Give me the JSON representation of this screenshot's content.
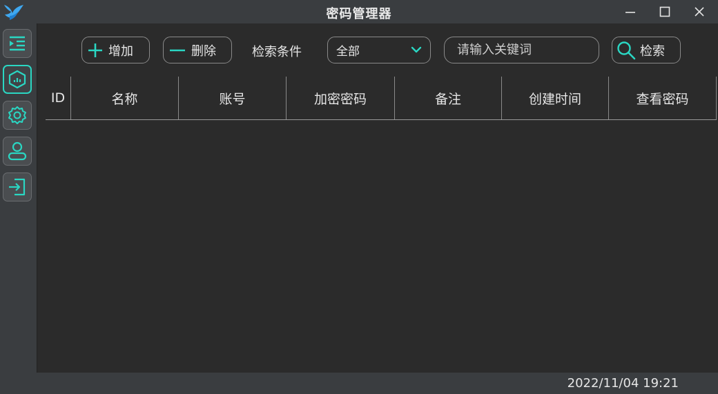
{
  "window": {
    "title": "密码管理器"
  },
  "toolbar": {
    "add_label": "增加",
    "delete_label": "删除",
    "condition_label": "检索条件",
    "condition_value": "全部",
    "search_placeholder": "请输入关键词",
    "search_label": "检索"
  },
  "table": {
    "columns": [
      "ID",
      "名称",
      "账号",
      "加密密码",
      "备注",
      "创建时间",
      "查看密码"
    ],
    "rows": []
  },
  "sidebar": {
    "items": [
      {
        "icon": "list-indent-icon"
      },
      {
        "icon": "dashboard-icon",
        "active": true
      },
      {
        "icon": "settings-icon"
      },
      {
        "icon": "user-icon"
      },
      {
        "icon": "logout-icon"
      }
    ]
  },
  "status": {
    "datetime": "2022/11/04 19:21"
  },
  "colors": {
    "accent": "#2ad7c3",
    "background": "#2b2b2b",
    "bar": "#3a3d40"
  }
}
